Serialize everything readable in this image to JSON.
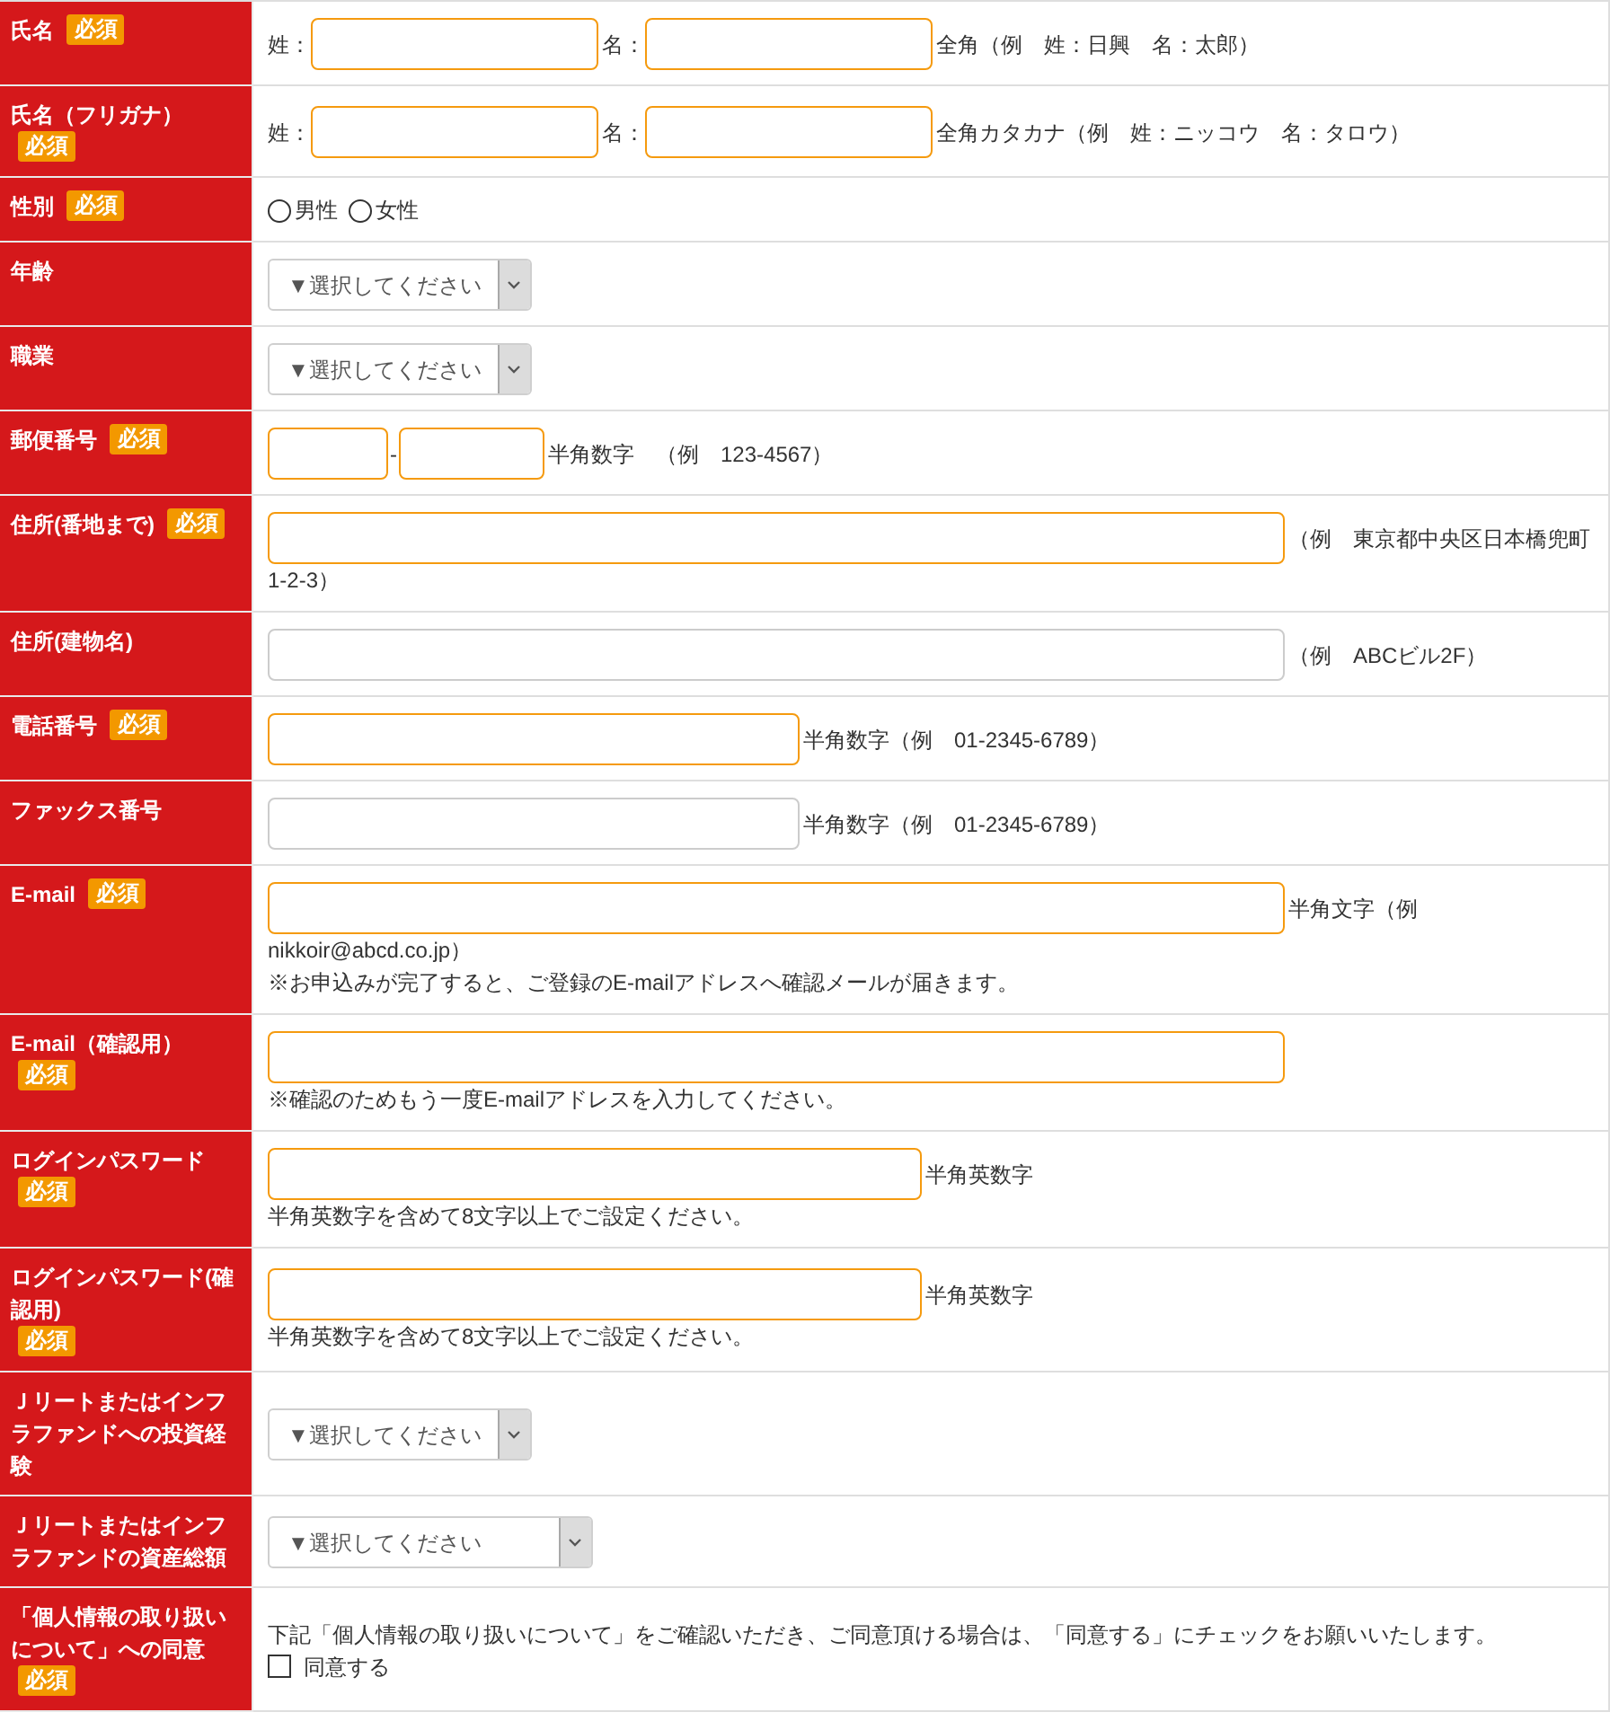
{
  "form": {
    "rows": [
      {
        "label": "氏名",
        "badge": "必須",
        "lines": [
          [
            {
              "kind": "caption",
              "text": "姓："
            },
            {
              "kind": "input",
              "highlighted": true
            },
            {
              "kind": "caption",
              "text": "名："
            },
            {
              "kind": "input",
              "highlighted": true
            },
            {
              "kind": "hint",
              "text": "全角（例　姓：日興　名：太郎）"
            }
          ]
        ]
      },
      {
        "label": "氏名（フリガナ）",
        "badge": "必須",
        "lines": [
          [
            {
              "kind": "caption",
              "text": "姓："
            },
            {
              "kind": "input",
              "highlighted": true
            },
            {
              "kind": "caption",
              "text": "名："
            },
            {
              "kind": "input",
              "highlighted": true
            },
            {
              "kind": "hint",
              "text": "全角カタカナ（例　姓：ニッコウ　名：タロウ）"
            }
          ]
        ]
      },
      {
        "label": "性別",
        "badge": "必須",
        "lines": [
          [
            {
              "kind": "radio",
              "label": "男性",
              "selected": false
            },
            {
              "kind": "radio",
              "label": "女性",
              "selected": false
            }
          ]
        ]
      },
      {
        "label": "年齢",
        "lines": [
          [
            {
              "kind": "select",
              "value": "▼選択してください"
            }
          ]
        ]
      },
      {
        "label": "職業",
        "lines": [
          [
            {
              "kind": "select",
              "value": "▼選択してください"
            }
          ]
        ]
      },
      {
        "label": "郵便番号",
        "badge": "必須",
        "lines": [
          [
            {
              "kind": "input",
              "highlighted": true
            },
            {
              "kind": "separator",
              "text": "-"
            },
            {
              "kind": "input",
              "highlighted": true
            },
            {
              "kind": "hint",
              "text": "半角数字　（例　123-4567）"
            }
          ]
        ]
      },
      {
        "label": "住所(番地まで)",
        "badge": "必須",
        "lines": [
          [
            {
              "kind": "input",
              "highlighted": true
            },
            {
              "kind": "hint",
              "text": "（例　東京都中央区日本橋兜町"
            }
          ],
          [
            {
              "kind": "hint",
              "text": "1-2-3）"
            }
          ]
        ]
      },
      {
        "label": "住所(建物名)",
        "lines": [
          [
            {
              "kind": "input",
              "highlighted": false
            },
            {
              "kind": "hint",
              "text": "（例　ABCビル2F）"
            }
          ]
        ]
      },
      {
        "label": "電話番号",
        "badge": "必須",
        "lines": [
          [
            {
              "kind": "input",
              "highlighted": true
            },
            {
              "kind": "hint",
              "text": "半角数字（例　01-2345-6789）"
            }
          ]
        ]
      },
      {
        "label": "ファックス番号",
        "lines": [
          [
            {
              "kind": "input",
              "highlighted": false
            },
            {
              "kind": "hint",
              "text": "半角数字（例　01-2345-6789）"
            }
          ]
        ]
      },
      {
        "label": "E-mail",
        "badge": "必須",
        "lines": [
          [
            {
              "kind": "input",
              "highlighted": true
            },
            {
              "kind": "hint",
              "text": "半角文字（例"
            }
          ],
          [
            {
              "kind": "hint",
              "text": "nikkoir@abcd.co.jp）"
            }
          ],
          [
            {
              "kind": "note",
              "text": "※お申込みが完了すると、ご登録のE-mailアドレスへ確認メールが届きます。"
            }
          ]
        ]
      },
      {
        "label": "E-mail（確認用）",
        "badge": "必須",
        "lines": [
          [
            {
              "kind": "input",
              "highlighted": true
            }
          ],
          [
            {
              "kind": "note",
              "text": "※確認のためもう一度E-mailアドレスを入力してください。"
            }
          ]
        ]
      },
      {
        "label": "ログインパスワード",
        "badge": "必須",
        "lines": [
          [
            {
              "kind": "input",
              "highlighted": true
            },
            {
              "kind": "hint",
              "text": "半角英数字"
            }
          ],
          [
            {
              "kind": "note",
              "text": "半角英数字を含めて8文字以上でご設定ください。"
            }
          ]
        ]
      },
      {
        "label": "ログインパスワード(確認用)",
        "badge": "必須",
        "lines": [
          [
            {
              "kind": "input",
              "highlighted": true
            },
            {
              "kind": "hint",
              "text": "半角英数字"
            }
          ],
          [
            {
              "kind": "note",
              "text": "半角英数字を含めて8文字以上でご設定ください。"
            }
          ]
        ]
      },
      {
        "label": "Ｊリートまたはインフラファンドへの投資経験",
        "lines": [
          [
            {
              "kind": "select",
              "value": "▼選択してください"
            }
          ]
        ]
      },
      {
        "label": "Ｊリートまたはインフラファンドの資産総額",
        "lines": [
          [
            {
              "kind": "select",
              "value": "▼選択してください"
            }
          ]
        ]
      },
      {
        "label": "「個人情報の取り扱いについて」への同意",
        "badge": "必須",
        "lines": [
          [
            {
              "kind": "note",
              "text": "下記「個人情報の取り扱いについて」をご確認いただき、ご同意頂ける場合は、「同意する」にチェックをお願いいたします。"
            }
          ],
          [
            {
              "kind": "checkbox",
              "label": "同意する",
              "checked": false
            }
          ]
        ]
      }
    ]
  }
}
